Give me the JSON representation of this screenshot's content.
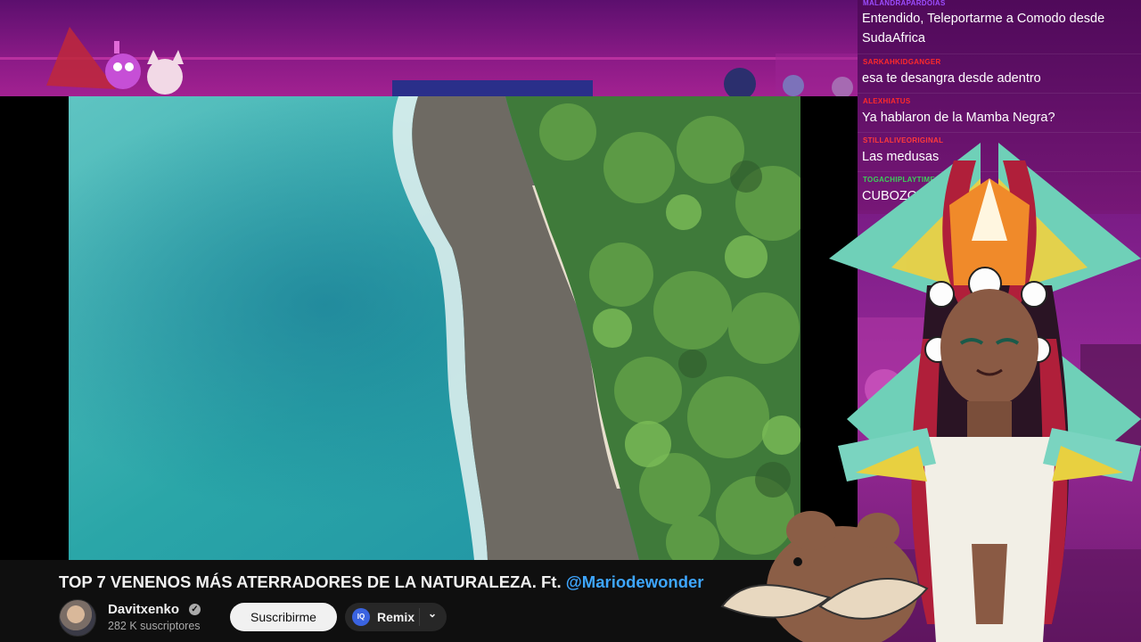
{
  "video": {
    "title_main": "TOP 7 VENENOS MÁS ATERRADORES DE LA NATURALEZA. Ft. ",
    "title_mention": "@Mariodewonder"
  },
  "channel": {
    "name": "Davitxenko",
    "subscribers": "282 K suscriptores",
    "verified_icon": "check-icon"
  },
  "actions": {
    "subscribe_label": "Suscribirme",
    "remix_label": "Remix",
    "remix_icon_text": "IQ"
  },
  "chat": {
    "messages": [
      {
        "user": "MALANDRAPARDOIAS",
        "text": "Entendido, Teleportarme a Comodo desde SudaAfrica",
        "color": "#9b4dff"
      },
      {
        "user": "SARKAHKIDGANGER",
        "text": "esa te desangra desde adentro",
        "color": "#ff2a2a"
      },
      {
        "user": "ALEXHIATUS",
        "text": "Ya hablaron de la Mamba Negra?",
        "color": "#ff2a2a"
      },
      {
        "user": "STILLALIVEORIGINAL",
        "text": "Las medusas",
        "color": "#ff3a3a"
      },
      {
        "user": "TOGACHIPLAYTIME",
        "text": "CUBOZOA!",
        "color": "#3ccf5a"
      }
    ]
  },
  "colors": {
    "ocean": "#2aa6a8",
    "youtube_bg": "#0f0f0f",
    "link": "#3ea6ff",
    "stream_purple": "#8a1a86"
  }
}
